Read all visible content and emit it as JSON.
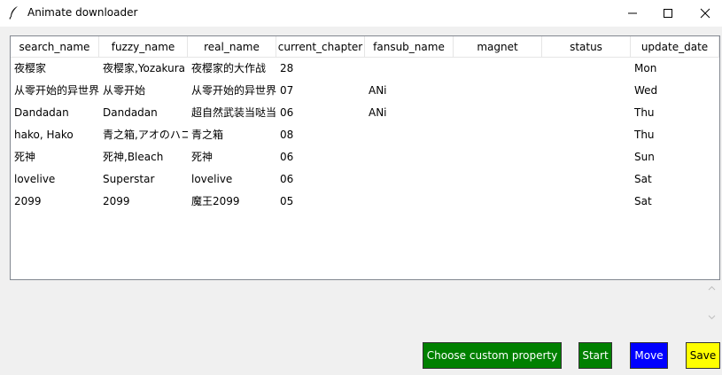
{
  "window": {
    "title": "Animate downloader",
    "icon": "feather-icon"
  },
  "table": {
    "columns": [
      "search_name",
      "fuzzy_name",
      "real_name",
      "current_chapter",
      "fansub_name",
      "magnet",
      "status",
      "update_date"
    ],
    "rows": [
      [
        "夜樱家",
        "夜樱家,Yozakura",
        "夜樱家的大作战",
        "28",
        "",
        "",
        "",
        "Mon"
      ],
      [
        "从零开始的异世界",
        "从零开始",
        "从零开始的异世界",
        "07",
        "ANi",
        "",
        "",
        "Wed"
      ],
      [
        "Dandadan",
        "Dandadan",
        "超自然武装当哒当",
        "06",
        "ANi",
        "",
        "",
        "Thu"
      ],
      [
        "hako, Hako",
        "青之箱,アオのハコ",
        "青之箱",
        "08",
        "",
        "",
        "",
        "Thu"
      ],
      [
        "死神",
        "死神,Bleach",
        "死神",
        "06",
        "",
        "",
        "",
        "Sun"
      ],
      [
        "lovelive",
        "Superstar",
        "lovelive",
        "06",
        "",
        "",
        "",
        "Sat"
      ],
      [
        "2099",
        "2099",
        "魔王2099",
        "05",
        "",
        "",
        "",
        "Sat"
      ]
    ]
  },
  "buttons": {
    "custom_label": "Choose custom property",
    "start_label": "Start",
    "move_label": "Move",
    "save_label": "Save"
  },
  "colors": {
    "custom_bg": "#008000",
    "start_bg": "#008000",
    "move_bg": "#0000ff",
    "save_bg": "#ffff00"
  }
}
